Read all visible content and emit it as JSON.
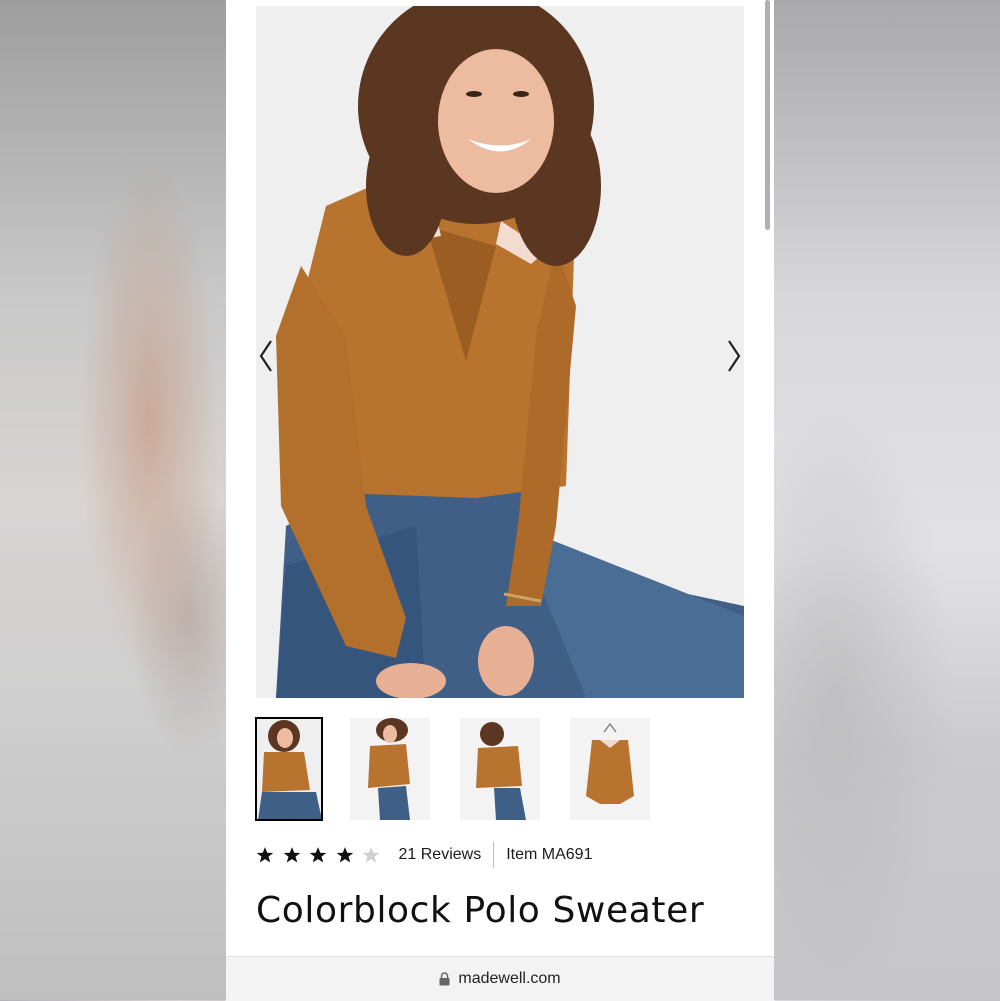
{
  "product": {
    "title": "Colorblock Polo Sweater",
    "rating": 4,
    "rating_max": 5,
    "reviews_label": "21 Reviews",
    "item_label": "Item MA691"
  },
  "gallery": {
    "thumbnail_count": 4,
    "active_thumbnail": 1
  },
  "browser": {
    "url": "madewell.com"
  },
  "icons": {
    "prev": "chevron-left-icon",
    "next": "chevron-right-icon",
    "star": "star-icon",
    "lock": "lock-icon"
  },
  "colors": {
    "sweater": "#b8742f",
    "denim": "#3f5f86",
    "collar": "#f2dcd0",
    "star_filled": "#111111",
    "star_empty": "#d0d0d0"
  }
}
